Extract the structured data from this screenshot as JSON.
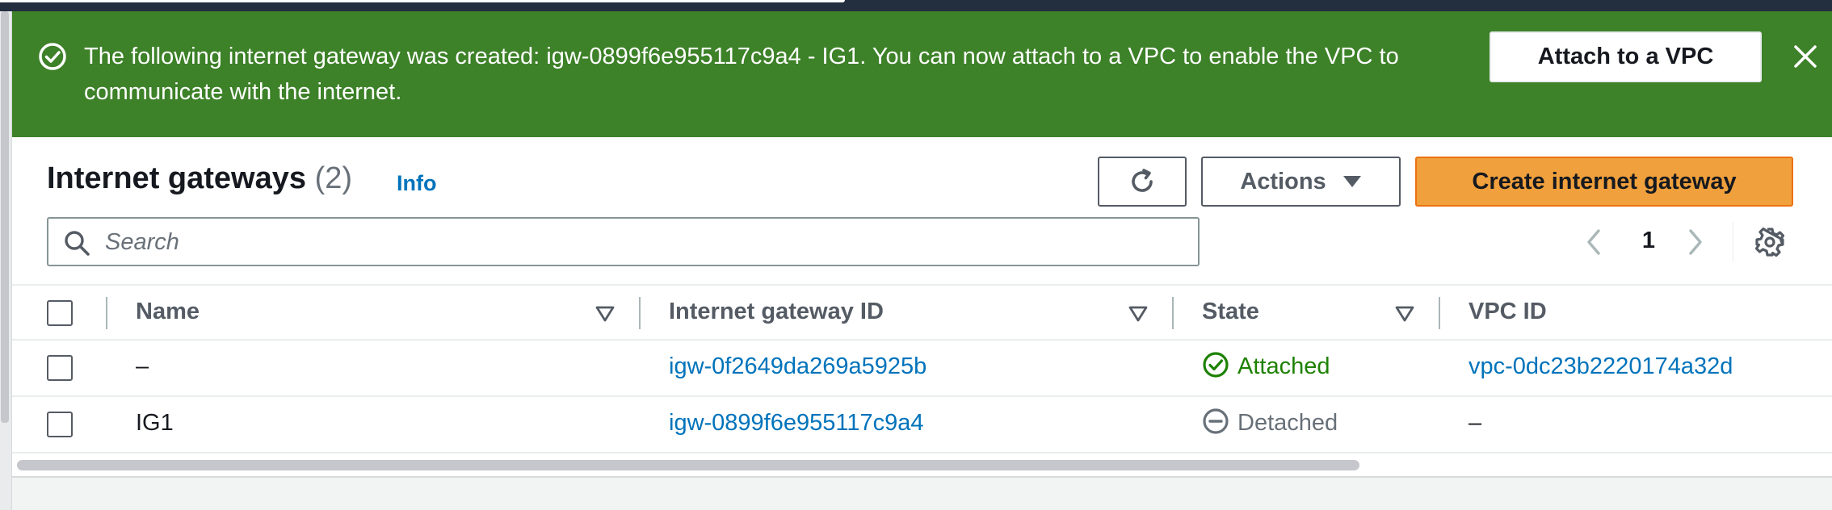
{
  "flash": {
    "message": "The following internet gateway was created: igw-0899f6e955117c9a4 - IG1. You can now attach to a VPC to enable the VPC to communicate with the internet.",
    "attach_label": "Attach to a VPC",
    "icon": "check-circle-icon",
    "close_icon": "close-icon",
    "color": "#3d8128"
  },
  "header": {
    "title": "Internet gateways",
    "count": "(2)",
    "info_label": "Info",
    "refresh_icon": "refresh-icon",
    "actions_label": "Actions",
    "create_label": "Create internet gateway",
    "primary_color": "#f0a03c"
  },
  "search": {
    "placeholder": "Search",
    "value": ""
  },
  "pagination": {
    "current_page": "1"
  },
  "table": {
    "columns": [
      "Name",
      "Internet gateway ID",
      "State",
      "VPC ID"
    ],
    "rows": [
      {
        "name": "–",
        "gateway_id": "igw-0f2649da269a5925b",
        "state": "Attached",
        "vpc_id": "vpc-0dc23b2220174a32d"
      },
      {
        "name": "IG1",
        "gateway_id": "igw-0899f6e955117c9a4",
        "state": "Detached",
        "vpc_id": "–"
      }
    ],
    "status_colors": {
      "attached": "#1d8102",
      "detached": "#687078"
    },
    "link_color": "#0073bb"
  }
}
